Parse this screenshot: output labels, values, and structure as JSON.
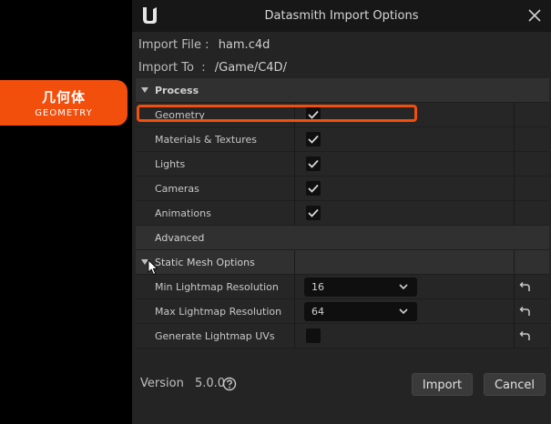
{
  "callout": {
    "cn": "几何体",
    "en": "GEOMETRY"
  },
  "dialog": {
    "title": "Datasmith Import Options",
    "import_file_label": "Import File :",
    "import_file_value": "ham.c4d",
    "import_to_label": "Import To  :",
    "import_to_value": "/Game/C4D/"
  },
  "sections": {
    "process": "Process",
    "advanced": "Advanced",
    "static_mesh": "Static Mesh Options"
  },
  "process_items": [
    {
      "label": "Geometry",
      "checked": true
    },
    {
      "label": "Materials & Textures",
      "checked": true
    },
    {
      "label": "Lights",
      "checked": true
    },
    {
      "label": "Cameras",
      "checked": true
    },
    {
      "label": "Animations",
      "checked": true
    }
  ],
  "mesh_options": {
    "min_lightmap": {
      "label": "Min Lightmap Resolution",
      "value": "16"
    },
    "max_lightmap": {
      "label": "Max Lightmap Resolution",
      "value": "64"
    },
    "generate_uvs": {
      "label": "Generate Lightmap UVs",
      "checked": false
    }
  },
  "footer": {
    "version_label": "Version",
    "version_value": "5.0.0",
    "import_button": "Import",
    "cancel_button": "Cancel"
  },
  "colors": {
    "accent": "#f24e0c",
    "dialog_bg": "#242424",
    "titlebar_bg": "#171717"
  },
  "icons": {
    "logo": "unreal-logo-icon",
    "close": "close-icon",
    "check": "check-icon",
    "dropdown": "chevron-down-icon",
    "reset": "reset-arrow-icon",
    "help": "help-icon",
    "cursor": "mouse-cursor-icon"
  }
}
